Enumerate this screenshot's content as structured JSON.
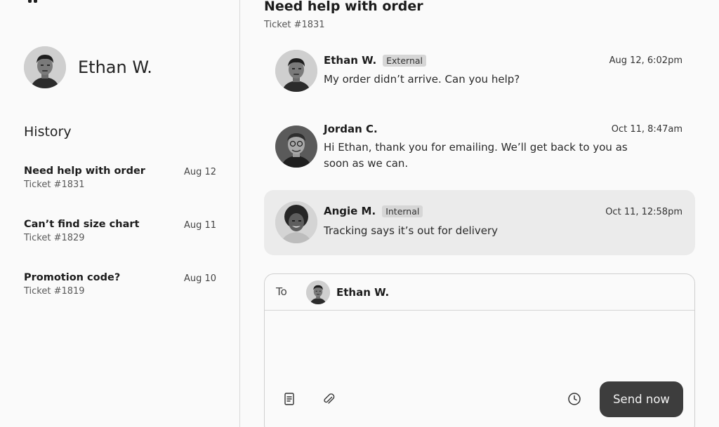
{
  "sidebar": {
    "profile": {
      "name": "Ethan W.",
      "avatar": "avatar-ethan"
    },
    "history_title": "History",
    "history": [
      {
        "title": "Need help with order",
        "ticket": "Ticket #1831",
        "date": "Aug 12"
      },
      {
        "title": "Can’t find size chart",
        "ticket": "Ticket #1829",
        "date": "Aug 11"
      },
      {
        "title": "Promotion code?",
        "ticket": "Ticket #1819",
        "date": "Aug 10"
      }
    ]
  },
  "main": {
    "title": "Need help with order",
    "ticket": "Ticket #1831",
    "messages": [
      {
        "author": "Ethan W.",
        "badge": "External",
        "time": "Aug 12, 6:02pm",
        "text": "My order didn’t arrive. Can you help?",
        "avatar": "avatar-ethan"
      },
      {
        "author": "Jordan C.",
        "badge": "",
        "time": "Oct 11, 8:47am",
        "text": "Hi Ethan, thank you for emailing. We’ll get back to you as soon as we can.",
        "avatar": "avatar-jordan"
      },
      {
        "author": "Angie M.",
        "badge": "Internal",
        "time": "Oct 11, 12:58pm",
        "text": "Tracking says it’s out for delivery",
        "avatar": "avatar-angie"
      }
    ]
  },
  "composer": {
    "to_label": "To",
    "recipient": "Ethan W.",
    "body": "",
    "send_label": "Send now",
    "icons": [
      "document-icon",
      "paperclip-icon",
      "clock-icon"
    ]
  },
  "colors": {
    "background": "#fafafa",
    "highlight": "#ebebeb",
    "badge": "#d6d6d6",
    "send_button": "#3d3d3d",
    "border": "#d9d9d9"
  }
}
